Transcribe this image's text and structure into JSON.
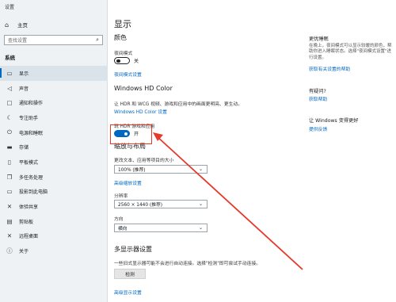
{
  "window": {
    "title": "设置"
  },
  "sidebar": {
    "home": {
      "label": "主页",
      "icon": "home-icon"
    },
    "search": {
      "placeholder": "查找设置",
      "icon": "search-icon"
    },
    "section": "系统",
    "items": [
      {
        "label": "显示",
        "icon": "monitor-icon",
        "active": true
      },
      {
        "label": "声音",
        "icon": "speaker-icon"
      },
      {
        "label": "通知和操作",
        "icon": "notification-icon"
      },
      {
        "label": "专注助手",
        "icon": "moon-icon"
      },
      {
        "label": "电源和睡眠",
        "icon": "power-icon"
      },
      {
        "label": "存储",
        "icon": "storage-icon"
      },
      {
        "label": "平板模式",
        "icon": "tablet-icon"
      },
      {
        "label": "多任务处理",
        "icon": "multitask-icon"
      },
      {
        "label": "投影到此电脑",
        "icon": "project-icon"
      },
      {
        "label": "体验共享",
        "icon": "share-icon"
      },
      {
        "label": "剪贴板",
        "icon": "clipboard-icon"
      },
      {
        "label": "远程桌面",
        "icon": "remote-desktop-icon"
      },
      {
        "label": "关于",
        "icon": "info-icon"
      }
    ]
  },
  "main": {
    "title": "显示",
    "color": {
      "heading": "颜色",
      "night_light_label": "夜间模式",
      "night_light_state": "关",
      "night_light_link": "夜间模式设置"
    },
    "hdr": {
      "heading": "Windows HD Color",
      "desc": "让 HDR 和 WCG 视频、游戏和应用中的画面更明亮、更生动。",
      "link": "Windows HD Color 设置",
      "toggle_label": "玩 HDR 游戏和应用",
      "toggle_state": "开"
    },
    "scale": {
      "heading": "缩放与布局",
      "text_size_label": "更改文本、应用等项目的大小",
      "text_size_value": "100% (推荐)",
      "advanced_link": "高级缩放设置",
      "resolution_label": "分辨率",
      "resolution_value": "2560 × 1440 (推荐)",
      "orientation_label": "方向",
      "orientation_value": "横向"
    },
    "multi": {
      "heading": "多显示器设置",
      "desc": "一些旧式显示器可能不会进行自动连接。选择\"检测\"即可尝试手动连接。",
      "detect_button": "检测",
      "advanced_link": "高级显示设置"
    }
  },
  "right": {
    "sleep_heading": "更优睡眠",
    "sleep_desc": "在晚上，夜间模式可以显示较暖的颜色，帮助你进入睡眠状态。选择\"夜间模式设置\"进行设置。",
    "sleep_link": "获取有关设置的帮助",
    "question_heading": "有疑问?",
    "question_link": "获取帮助",
    "better_heading": "让 Windows 变得更好",
    "better_link": "提供反馈"
  },
  "colors": {
    "accent": "#0067c0",
    "sidebar_bg": "#eef2f5",
    "annotation": "#e53929"
  }
}
